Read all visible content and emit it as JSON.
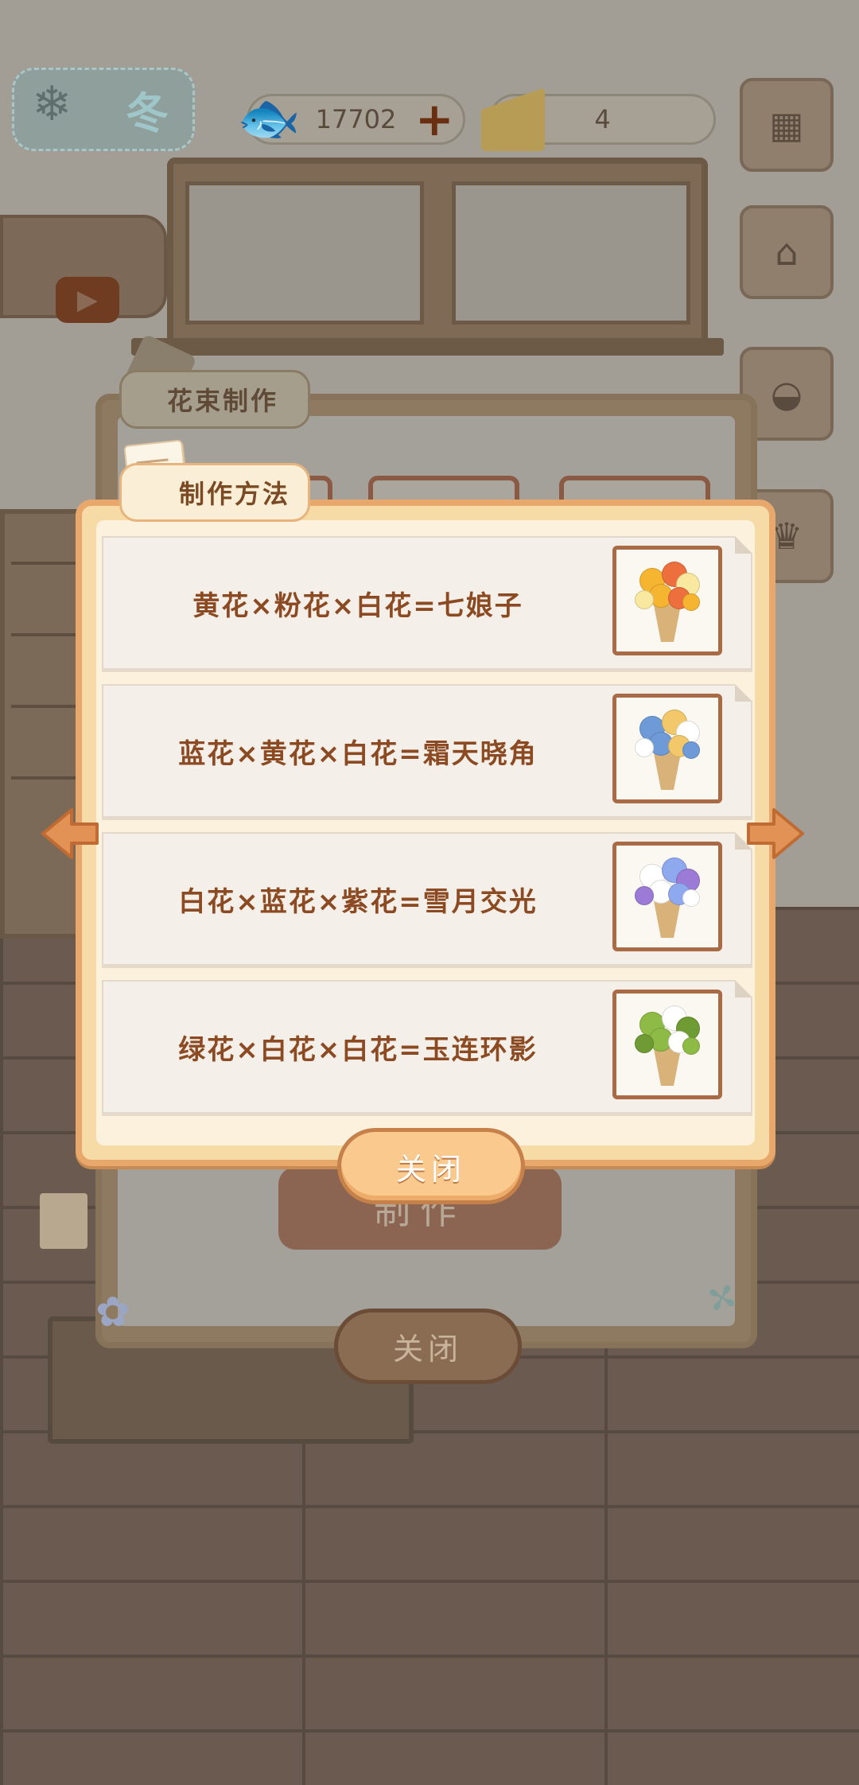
{
  "hud": {
    "season_label": "冬",
    "fish_count": "17702",
    "cheese_count": "4",
    "plus_symbol": "+"
  },
  "back_panel": {
    "tab_label": "花束制作",
    "craft_button": "制作",
    "close_button": "关闭"
  },
  "recipe_dialog": {
    "tab_label": "制作方法",
    "close_button": "关闭",
    "recipes": [
      {
        "text": "黄花×粉花×白花=七娘子",
        "icon": "bouquet-yellow-orange-icon",
        "colors": [
          "#f6b531",
          "#ee6f3e",
          "#f9e8a0"
        ]
      },
      {
        "text": "蓝花×黄花×白花=霜天晓角",
        "icon": "bouquet-blue-hydrangea-icon",
        "colors": [
          "#6e9bd8",
          "#f3c86a",
          "#ffffff"
        ]
      },
      {
        "text": "白花×蓝花×紫花=雪月交光",
        "icon": "bouquet-white-purple-icon",
        "colors": [
          "#ffffff",
          "#8fa9ef",
          "#9b7bd6"
        ]
      },
      {
        "text": "绿花×白花×白花=玉连环影",
        "icon": "bouquet-green-white-icon",
        "colors": [
          "#8dbb45",
          "#ffffff",
          "#6f9b34"
        ]
      }
    ]
  },
  "colors": {
    "dialog_border": "#e9a86b",
    "recipe_text": "#8c4a22",
    "thumb_border": "#a96b46",
    "arrow": "#e39256"
  }
}
